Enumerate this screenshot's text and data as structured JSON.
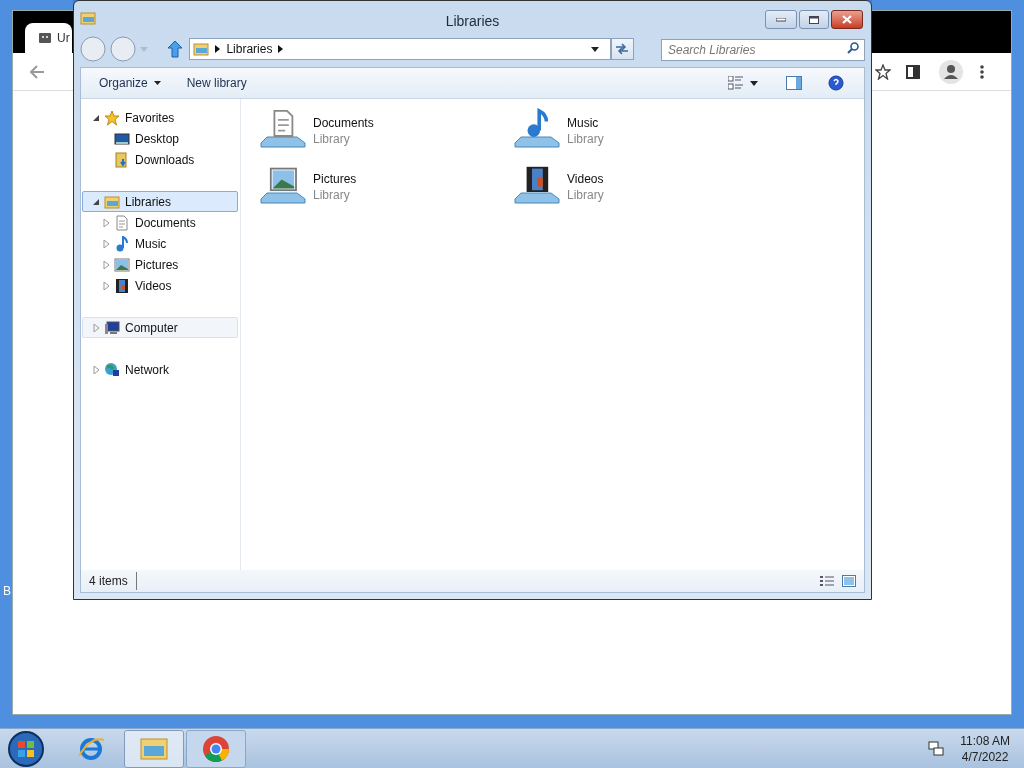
{
  "desktop": {
    "icon_label": "B"
  },
  "browser": {
    "tab_title": "Ur"
  },
  "explorer": {
    "title": "Libraries",
    "breadcrumb": [
      "Libraries"
    ],
    "search": {
      "placeholder": "Search Libraries"
    },
    "toolbar": [
      {
        "label": "Organize",
        "menu": true
      },
      {
        "label": "New library",
        "menu": false
      }
    ],
    "nav": [
      {
        "label": "Favorites",
        "expanded": true,
        "selected": false,
        "hovered": false,
        "children": [
          {
            "label": "Desktop"
          },
          {
            "label": "Downloads"
          }
        ]
      },
      {
        "label": "Libraries",
        "expanded": true,
        "selected": true,
        "hovered": false,
        "children": [
          {
            "label": "Documents",
            "expanded": false
          },
          {
            "label": "Music",
            "expanded": false
          },
          {
            "label": "Pictures",
            "expanded": false
          },
          {
            "label": "Videos",
            "expanded": false
          }
        ]
      },
      {
        "label": "Computer",
        "expanded": false,
        "selected": false,
        "hovered": true
      },
      {
        "label": "Network",
        "expanded": false,
        "selected": false,
        "hovered": false
      }
    ],
    "items": [
      {
        "name": "Documents",
        "type": "Library"
      },
      {
        "name": "Music",
        "type": "Library"
      },
      {
        "name": "Pictures",
        "type": "Library"
      },
      {
        "name": "Videos",
        "type": "Library"
      }
    ],
    "status": "4 items"
  },
  "taskbar": {
    "apps": [
      {
        "selected": false
      },
      {
        "selected": true
      },
      {
        "selected": false
      }
    ],
    "time": "11:08 AM",
    "date": "4/7/2022"
  }
}
